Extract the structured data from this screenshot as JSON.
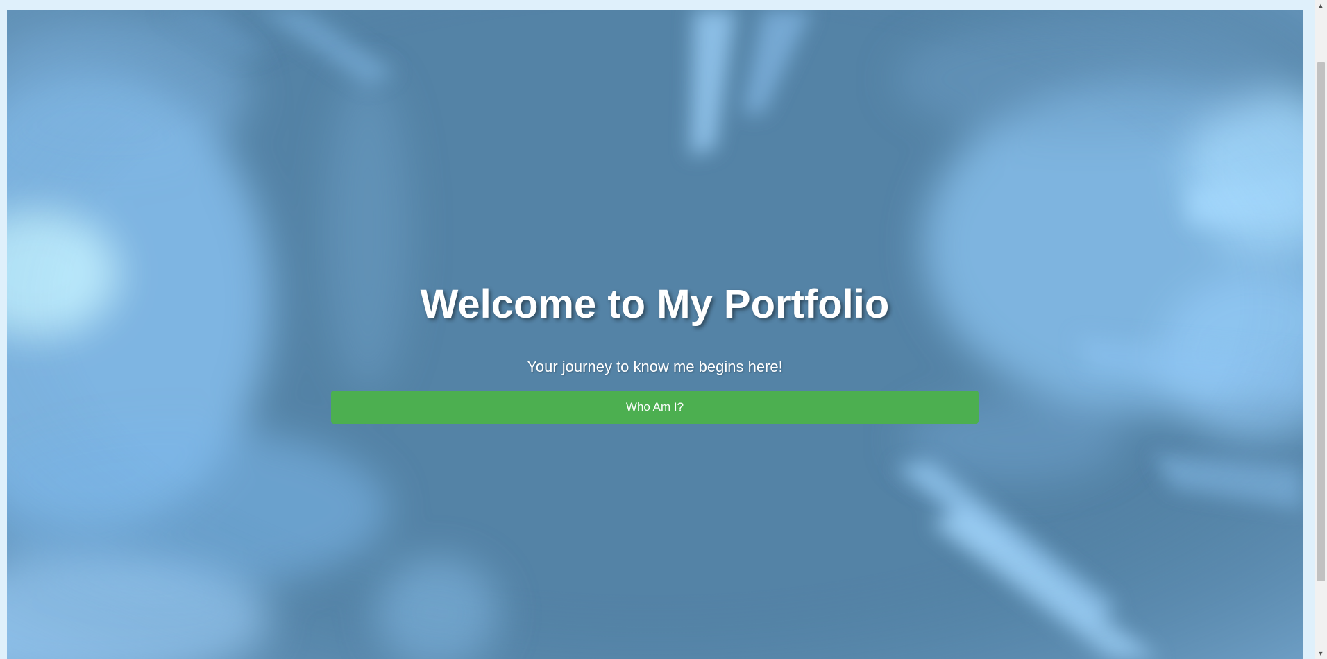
{
  "hero": {
    "title": "Welcome to My Portfolio",
    "subtitle": "Your journey to know me begins here!",
    "button_label": "Who Am I?"
  },
  "colors": {
    "page_background": "#dff0fb",
    "hero_overlay": "#5483a6",
    "button_background": "#4caf50",
    "text": "#ffffff"
  },
  "scrollbar": {
    "up_icon": "chevron-up-icon",
    "down_icon": "chevron-down-icon"
  }
}
